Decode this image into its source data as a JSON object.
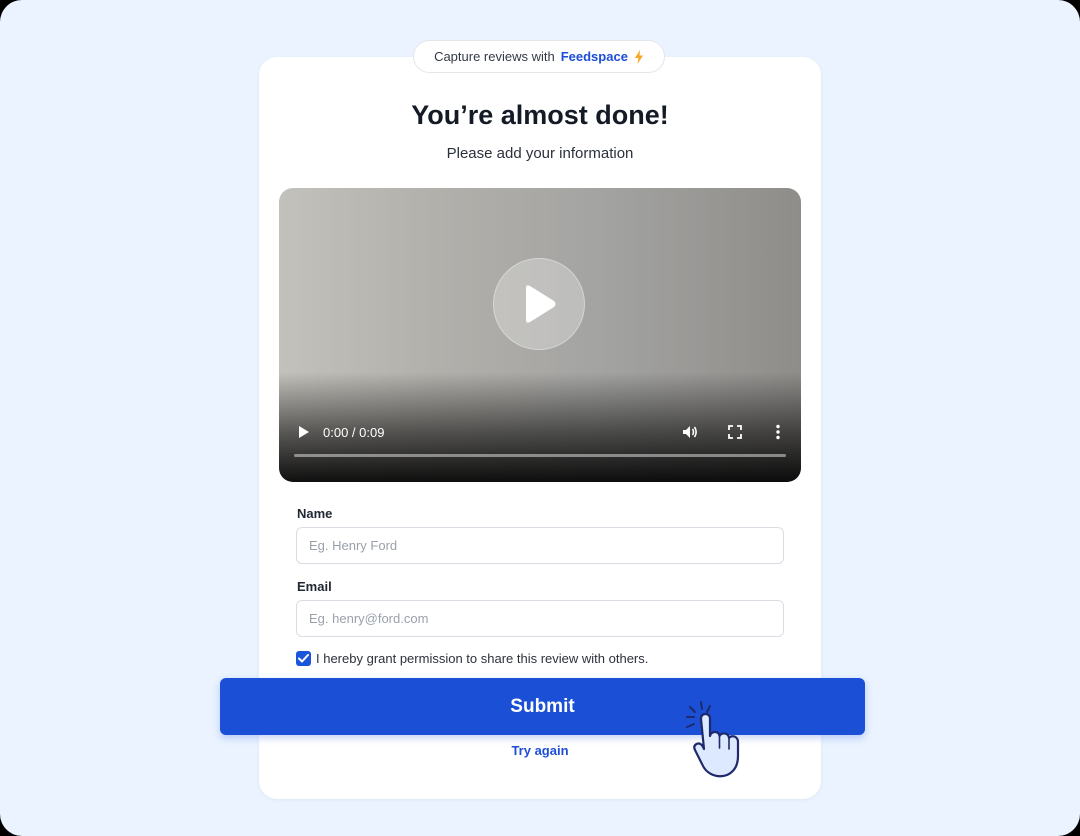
{
  "brand_pill": {
    "prefix": "Capture reviews with",
    "brand_name": "Feedspace",
    "bolt_icon": "lightning-bolt-icon",
    "bolt_color": "#f5a623"
  },
  "header": {
    "title": "You’re almost done!",
    "subtitle": "Please add your information"
  },
  "video": {
    "time": "0:00 / 0:09",
    "progress": 0,
    "icons": [
      "play-icon",
      "volume-icon",
      "fullscreen-icon",
      "more-options-icon"
    ]
  },
  "form": {
    "name_label": "Name",
    "name_placeholder": "Eg. Henry Ford",
    "name_value": "",
    "email_label": "Email",
    "email_placeholder": "Eg. henry@ford.com",
    "email_value": "",
    "consent_checked": true,
    "consent_text": "I hereby grant permission to share this review with others."
  },
  "actions": {
    "submit_label": "Submit",
    "try_again_label": "Try again"
  },
  "colors": {
    "accent": "#1a4fd6",
    "background": "#eaf3ff",
    "card": "#ffffff"
  }
}
